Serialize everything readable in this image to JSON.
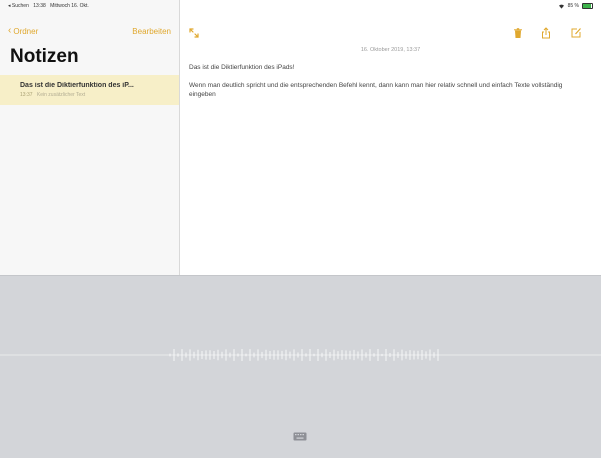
{
  "status_bar": {
    "back_app": "◂ Suchen",
    "time": "13:38",
    "date": "Mittwoch 16. Okt.",
    "battery_text": "85 %"
  },
  "sidebar": {
    "back_label": "Ordner",
    "edit_label": "Bearbeiten",
    "title": "Notizen",
    "notes": [
      {
        "title": "Das ist die Diktierfunktion des iP...",
        "time": "13:37",
        "preview": "Kein zusätzlicher Text"
      }
    ]
  },
  "note": {
    "date": "16. Oktober 2019, 13:37",
    "line1": "Das ist die Diktierfunktion des iPads!",
    "line2": "Wenn man deutlich spricht und die entsprechenden Befehl kennt, dann kann man hier relativ schnell und einfach Texte vollständig eingeben"
  },
  "colors": {
    "accent": "#e0a82e",
    "selected_note_bg": "#f7efc8",
    "dictation_bg": "#d3d5d9",
    "battery_green": "#3cb24a"
  },
  "icons": [
    "expand-icon",
    "trash-icon",
    "share-icon",
    "compose-icon",
    "keyboard-icon",
    "battery-icon",
    "wifi-icon"
  ]
}
